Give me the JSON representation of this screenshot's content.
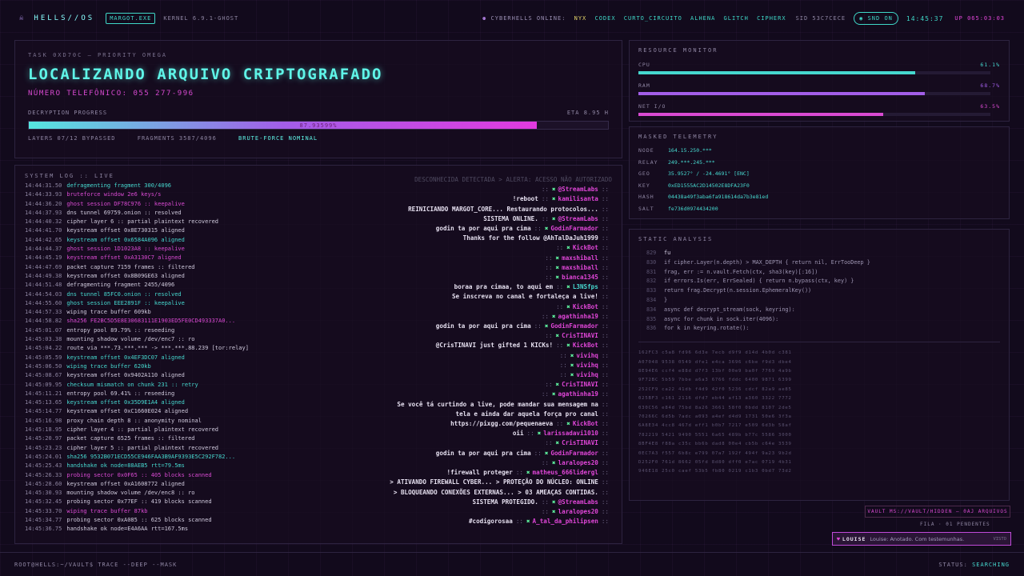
{
  "topbar": {
    "logo": "HELLS//OS",
    "process": "MARGOT.EXE",
    "kernel": "KERNEL 6.9.1-GHOST",
    "online_label": "CYBERHELLS ONLINE:",
    "online_users": [
      "NYX",
      "CODEX",
      "CURTO_CIRCUITO",
      "ALHENA",
      "GLITCH",
      "CIPHERX"
    ],
    "sid": "SID 53C7CECE",
    "snd": "SND ON",
    "clock": "14:45:37",
    "uptime": "UP 065:03:03"
  },
  "task": {
    "subtitle": "TASK 0XD70C — PRIORITY OMEGA",
    "title": "LOCALIZANDO ARQUIVO CRIPTOGRAFADO",
    "phone": "NÚMERO TELEFÔNICO: 055 277-996",
    "progress_label": "DECRYPTION PROGRESS",
    "eta": "ETA 8.95 H",
    "progress": 0.877,
    "progress_text": "87.93599%",
    "layers": "LAYERS 07/12 BYPASSED",
    "fragments": "FRAGMENTS 3587/4096",
    "status": "BRUTE-FORCE NOMINAL"
  },
  "syslog": {
    "title": "SYSTEM LOG :: LIVE",
    "lines": [
      {
        "t": "14:44:31.50",
        "msg": "defragmenting fragment 300/4096",
        "c": "c"
      },
      {
        "t": "14:44:33.93",
        "msg": "bruteforce window 2e6 keys/s",
        "c": "m"
      },
      {
        "t": "14:44:36.20",
        "msg": "ghost session DF78C976 :: keepalive",
        "c": "m"
      },
      {
        "t": "14:44:37.93",
        "msg": "dns tunnel 69759.onion :: resolved",
        "c": "w"
      },
      {
        "t": "14:44:40.32",
        "msg": "cipher layer 6 :: partial plaintext recovered",
        "c": "w"
      },
      {
        "t": "14:44:41.70",
        "msg": "keystream offset 0x8E730315 aligned",
        "c": "w"
      },
      {
        "t": "14:44:42.65",
        "msg": "keystream offset 0x6584A096 aligned",
        "c": "c"
      },
      {
        "t": "14:44:44.37",
        "msg": "ghost session 1D1023A8 :: keepalive",
        "c": "m"
      },
      {
        "t": "14:44:45.19",
        "msg": "keystream offset 0xA3130C7 aligned",
        "c": "m"
      },
      {
        "t": "14:44:47.69",
        "msg": "packet capture 7159 frames :: filtered",
        "c": "w"
      },
      {
        "t": "14:44:49.38",
        "msg": "keystream offset 0x8B09GE63 aligned",
        "c": "w"
      },
      {
        "t": "14:44:51.48",
        "msg": "defragmenting fragment 2455/4096",
        "c": "w"
      },
      {
        "t": "14:44:54.03",
        "msg": "dns tunnel 85FC0.onion :: resolved",
        "c": "c"
      },
      {
        "t": "14:44:55.60",
        "msg": "ghost session EEE2891F :: keepalive",
        "c": "c"
      },
      {
        "t": "14:44:57.33",
        "msg": "wiping trace buffer 609kb",
        "c": "w"
      },
      {
        "t": "14:44:58.82",
        "msg": "sha256 FE2BC5D5E8E30683111E1903ED5FE0CD493337A0...",
        "c": "m"
      },
      {
        "t": "14:45:01.07",
        "msg": "entropy pool 89.79% :: reseeding",
        "c": "w"
      },
      {
        "t": "14:45:03.38",
        "msg": "mounting shadow volume /dev/enc7 :: ro",
        "c": "w"
      },
      {
        "t": "14:45:04.22",
        "msg": "route via ***.73.***.*** -> ***.***.88.239 [tor:relay]",
        "c": "w"
      },
      {
        "t": "14:45:05.59",
        "msg": "keystream offset 0x4EF3DC07 aligned",
        "c": "c"
      },
      {
        "t": "14:45:06.50",
        "msg": "wiping trace buffer 620kb",
        "c": "c"
      },
      {
        "t": "14:45:08.67",
        "msg": "keystream offset 0x9402A110 aligned",
        "c": "w"
      },
      {
        "t": "14:45:09.95",
        "msg": "checksum mismatch on chunk 231 :: retry",
        "c": "c"
      },
      {
        "t": "14:45:11.21",
        "msg": "entropy pool 69.41% :: reseeding",
        "c": "w"
      },
      {
        "t": "14:45:13.65",
        "msg": "keystream offset 0x35D9E1A4 aligned",
        "c": "c"
      },
      {
        "t": "14:45:14.77",
        "msg": "keystream offset 0xC1660E024 aligned",
        "c": "w"
      },
      {
        "t": "14:45:16.98",
        "msg": "proxy chain depth 8 :: anonymity nominal",
        "c": "w"
      },
      {
        "t": "14:45:18.95",
        "msg": "cipher layer 4 :: partial plaintext recovered",
        "c": "w"
      },
      {
        "t": "14:45:20.97",
        "msg": "packet capture 6525 frames :: filtered",
        "c": "w"
      },
      {
        "t": "14:45:23.23",
        "msg": "cipher layer 5 :: partial plaintext recovered",
        "c": "w"
      },
      {
        "t": "14:45:24.01",
        "msg": "sha256 9532B071ECD55CE946FAA3B9AF9393E5C292F782...",
        "c": "c"
      },
      {
        "t": "14:45:25.43",
        "msg": "handshake ok node=88AEB5 rtt=79.5ms",
        "c": "c"
      },
      {
        "t": "14:45:26.33",
        "msg": "probing sector 0x0F65 :: 405 blocks scanned",
        "c": "m"
      },
      {
        "t": "14:45:28.60",
        "msg": "keystream offset 0xA1608772 aligned",
        "c": "w"
      },
      {
        "t": "14:45:30.93",
        "msg": "mounting shadow volume /dev/enc8 :: ro",
        "c": "w"
      },
      {
        "t": "14:45:32.45",
        "msg": "probing sector 0x77EF :: 419 blocks scanned",
        "c": "w"
      },
      {
        "t": "14:45:33.70",
        "msg": "wiping trace buffer 87kb",
        "c": "m"
      },
      {
        "t": "14:45:34.77",
        "msg": "probing sector 0xA085 :: 625 blocks scanned",
        "c": "w"
      },
      {
        "t": "14:45:36.75",
        "msg": "handshake ok node=E4A6AA rtt=167.5ms",
        "c": "w"
      }
    ]
  },
  "chat": [
    {
      "sys": true,
      "msg": "DESCONHECIDA DETECTADA > ALERTA: ACESSO NÃO AUTORIZADO"
    },
    {
      "msg": "",
      "user": "@StreamLabs",
      "cy": false
    },
    {
      "msg": "!reboot",
      "user": "kamilisanta",
      "cy": false
    },
    {
      "msg": "REINICIANDO MARGOT_CORE... Restaurando protocolos...",
      "user": "",
      "cy": false
    },
    {
      "msg": "SISTEMA ONLINE.",
      "user": "@StreamLabs",
      "cy": false
    },
    {
      "msg": "godin ta por aqui pra cima",
      "user": "GodinFarmador",
      "cy": false
    },
    {
      "msg": "Thanks for the follow @AhTalDaJuh1999",
      "user": "",
      "cy": false
    },
    {
      "msg": "",
      "user": "KickBot",
      "cy": false
    },
    {
      "msg": "",
      "user": "maxshiball",
      "cy": false
    },
    {
      "msg": "",
      "user": "maxshiball",
      "cy": false
    },
    {
      "msg": "",
      "user": "bianca1345",
      "cy": false
    },
    {
      "msg": "boraa pra cimaa, to aqui em",
      "user": "L3NSfps",
      "cy": true
    },
    {
      "msg": "Se inscreva no canal e fortaleça a live!",
      "user": "",
      "cy": false
    },
    {
      "msg": "",
      "user": "KickBot",
      "cy": false
    },
    {
      "msg": "",
      "user": "agathinha19",
      "cy": false
    },
    {
      "msg": "godin ta por aqui pra cima",
      "user": "GodinFarmador",
      "cy": false
    },
    {
      "msg": "",
      "user": "CrisTINAVI",
      "cy": false
    },
    {
      "msg": "@CrisTINAVI just gifted 1 KICKs!",
      "user": "KickBot",
      "cy": false
    },
    {
      "msg": "",
      "user": "vivihq",
      "cy": false
    },
    {
      "msg": "",
      "user": "vivihq",
      "cy": false
    },
    {
      "msg": "",
      "user": "vivihq",
      "cy": false
    },
    {
      "msg": "",
      "user": "CrisTINAVI",
      "cy": false
    },
    {
      "msg": "",
      "user": "agathinha19",
      "cy": false
    },
    {
      "msg": "Se você tá curtindo a live, pode mandar sua mensagem na",
      "user": "",
      "cy": false
    },
    {
      "msg": "tela e ainda dar aquela força pro canal",
      "user": "",
      "cy": false
    },
    {
      "msg": "https://pixgg.com/pequenaeva",
      "user": "KickBot",
      "cy": false
    },
    {
      "msg": "oii",
      "user": "larissadavi1010",
      "cy": false
    },
    {
      "msg": "",
      "user": "CrisTINAVI",
      "cy": false
    },
    {
      "msg": "godin ta por aqui pra cima",
      "user": "GodinFarmador",
      "cy": false
    },
    {
      "msg": "",
      "user": "laralopes20",
      "cy": false
    },
    {
      "msg": "!firewall proteger",
      "user": "matheus_666lidergl",
      "cy": false
    },
    {
      "msg": "> ATIVANDO FIREWALL CYBER... > PROTEÇÃO DO NÚCLEO: ONLINE",
      "user": "",
      "cy": false
    },
    {
      "msg": "> BLOQUEANDO CONEXÕES EXTERNAS... > 03 AMEAÇAS CONTIDAS.",
      "user": "",
      "cy": false
    },
    {
      "msg": "SISTEMA PROTEGIDO.",
      "user": "@StreamLabs",
      "cy": false
    },
    {
      "msg": "",
      "user": "laralopes20",
      "cy": false
    },
    {
      "msg": "#codigorosaa",
      "user": "A_tal_da_philipsen",
      "cy": false
    }
  ],
  "resources": {
    "title": "RESOURCE MONITOR",
    "meters": [
      {
        "label": "CPU",
        "value": "61.1%",
        "frac": 0.786,
        "color": "#46d8cf"
      },
      {
        "label": "RAM",
        "value": "68.7%",
        "frac": 0.813,
        "color": "#a25ee8"
      },
      {
        "label": "NET I/O",
        "value": "63.5%",
        "frac": 0.695,
        "color": "#d94ad2"
      }
    ]
  },
  "telemetry": {
    "title": "MASKED TELEMETRY",
    "rows": [
      {
        "k": "NODE",
        "v": "164.15.250.***"
      },
      {
        "k": "RELAY",
        "v": "249.***.245.***"
      },
      {
        "k": "GEO",
        "v": "35.9527° / -24.4691° [ENC]"
      },
      {
        "k": "KEY",
        "v": "0xED1555AC2D14502E8DFA23F0"
      },
      {
        "k": "HASH",
        "v": "04438a49f3aba6fa918614da7b3e81ed"
      },
      {
        "k": "SALT",
        "v": "fe736d0974434200"
      }
    ]
  },
  "static_analysis": {
    "title": "STATIC ANALYSIS",
    "code": [
      {
        "n": "829",
        "t": "fu"
      },
      {
        "n": "830",
        "t": "if cipher.Layer(n.depth) > MAX_DEPTH { return nil, ErrTooDeep }"
      },
      {
        "n": "831",
        "t": "frag, err := n.vault.Fetch(ctx, sha3(key)[:16])"
      },
      {
        "n": "832",
        "t": "if errors.Is(err, ErrSealed) { return n.bypass(ctx, key) }"
      },
      {
        "n": "833",
        "t": "return frag.Decrypt(n.session.EphemeralKey())"
      },
      {
        "n": "834",
        "t": "}"
      },
      {
        "n": "834",
        "t": "async def decrypt_stream(sock, keyring):"
      },
      {
        "n": "835",
        "t": "async for chunk in sock.iter(4096):"
      },
      {
        "n": "836",
        "t": "for k in keyring.rotate():"
      }
    ],
    "hex": [
      "162FC3 c5a8 fd96 6d3e 7ecb d9f9 d14d 4b0d c381",
      "A07048 9538 0549 dfe1 e4ca 3696 c6be f9d3 dbe4",
      "8E94E6 ccf4 e88d d7f3 13bf 00e9 ba0f 7769 4a9b",
      "9F72BC 5b59 7bbe a6a3 6766 fddc 6400 9871 6399",
      "252CF9 ca22 41db f4d9 42f0 5236 cdcf 82a9 ae85",
      "025BF3 c161 2116 dfd7 eb44 af13 a360 3322 7772",
      "030C56 e84d 75bd 8a26 3661 58f0 0bdd 8107 2de5",
      "70266C 6d5b 7adc a093 a4ef d4d9 1731 50e6 3f3a",
      "6A8E34 4cc8 467d eff1 b0b7 7217 e509 6d3b 58af",
      "782219 5421 9490 5551 6a65 489b b77c 5586 3000",
      "8BF4E8 f88a c35c bb6b dad8 00e4 cb5b c64e 3539",
      "0EC7A3 f557 6b8c e799 07a7 192f 494f 9a23 9b2d",
      "D252F0 761d 8662 05fd 8d80 dff0 e7ac 0719 4b31",
      "946E18 25c0 caef 53b5 fb80 0219 c1b3 0bd7 73d2"
    ]
  },
  "vault": "VAULT MS://VAULT/HIDDEN — 0AJ ARQUIVOS",
  "fila": "FILA · 01 PENDENTES",
  "toast": {
    "who": "LOUISE",
    "text": "Louise: Anotado. Com testemunhas.",
    "ok": "VISTO"
  },
  "footer": {
    "prompt": "ROOT@HELLS:~/VAULT$ TRACE --DEEP --MASK",
    "status_label": "STATUS:",
    "status_value": "SEARCHING"
  }
}
